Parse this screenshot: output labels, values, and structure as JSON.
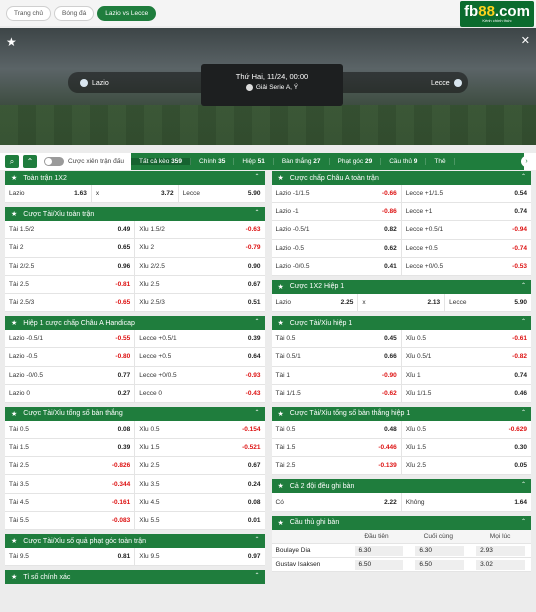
{
  "breadcrumbs": [
    "Trang chủ",
    "Bóng đá",
    "Lazio vs Lecce"
  ],
  "logo": {
    "brand_a": "fb",
    "brand_b": "88",
    "suffix": ".com",
    "tag": "Kênh chính thức"
  },
  "match": {
    "home": "Lazio",
    "away": "Lecce",
    "datetime": "Thứ Hai, 11/24, 00:00",
    "league": "Giải Serie A, Ý"
  },
  "toolbar": {
    "parlay": "Cược xiên trận đấu"
  },
  "tabs": [
    {
      "label": "Tất cả kèo",
      "count": "359"
    },
    {
      "label": "Chính",
      "count": "35"
    },
    {
      "label": "Hiệp",
      "count": "51"
    },
    {
      "label": "Bàn thắng",
      "count": "27"
    },
    {
      "label": "Phạt góc",
      "count": "29"
    },
    {
      "label": "Cầu thủ",
      "count": "9"
    },
    {
      "label": "Thẻ",
      "count": ""
    }
  ],
  "left": [
    {
      "title": "Toàn trận 1X2",
      "rows": [
        [
          [
            "Lazio",
            "1.63"
          ],
          [
            "x",
            "3.72"
          ],
          [
            "Lecce",
            "5.90"
          ]
        ]
      ]
    },
    {
      "title": "Cược Tài/Xỉu toàn trận",
      "rows": [
        [
          [
            "Tài 1.5/2",
            "0.49"
          ],
          [
            "Xỉu 1.5/2",
            "-0.63"
          ]
        ],
        [
          [
            "Tài 2",
            "0.65"
          ],
          [
            "Xỉu 2",
            "-0.79"
          ]
        ],
        [
          [
            "Tài 2/2.5",
            "0.96"
          ],
          [
            "Xỉu 2/2.5",
            "0.90"
          ]
        ],
        [
          [
            "Tài 2.5",
            "-0.81"
          ],
          [
            "Xỉu 2.5",
            "0.67"
          ]
        ],
        [
          [
            "Tài 2.5/3",
            "-0.65"
          ],
          [
            "Xỉu 2.5/3",
            "0.51"
          ]
        ]
      ]
    },
    {
      "title": "Hiệp 1 cược chấp Châu A Handicap",
      "rows": [
        [
          [
            "Lazio -0.5/1",
            "-0.55"
          ],
          [
            "Lecce +0.5/1",
            "0.39"
          ]
        ],
        [
          [
            "Lazio -0.5",
            "-0.80"
          ],
          [
            "Lecce +0.5",
            "0.64"
          ]
        ],
        [
          [
            "Lazio -0/0.5",
            "0.77"
          ],
          [
            "Lecce +0/0.5",
            "-0.93"
          ]
        ],
        [
          [
            "Lazio 0",
            "0.27"
          ],
          [
            "Lecce 0",
            "-0.43"
          ]
        ]
      ]
    },
    {
      "title": "Cược Tài/Xỉu tổng số bàn thắng",
      "rows": [
        [
          [
            "Tài 0.5",
            "0.08"
          ],
          [
            "Xỉu 0.5",
            "-0.154"
          ]
        ],
        [
          [
            "Tài 1.5",
            "0.39"
          ],
          [
            "Xỉu 1.5",
            "-0.521"
          ]
        ],
        [
          [
            "Tài 2.5",
            "-0.826"
          ],
          [
            "Xỉu 2.5",
            "0.67"
          ]
        ],
        [
          [
            "Tài 3.5",
            "-0.344"
          ],
          [
            "Xỉu 3.5",
            "0.24"
          ]
        ],
        [
          [
            "Tài 4.5",
            "-0.161"
          ],
          [
            "Xỉu 4.5",
            "0.08"
          ]
        ],
        [
          [
            "Tài 5.5",
            "-0.083"
          ],
          [
            "Xỉu 5.5",
            "0.01"
          ]
        ]
      ]
    },
    {
      "title": "Cược Tài/Xỉu số quả phạt góc toàn trận",
      "rows": [
        [
          [
            "Tài 9.5",
            "0.81"
          ],
          [
            "Xỉu 9.5",
            "0.97"
          ]
        ]
      ]
    },
    {
      "title": "Tỉ số chính xác",
      "rows": []
    }
  ],
  "right": [
    {
      "title": "Cược chấp Châu A toàn trận",
      "rows": [
        [
          [
            "Lazio -1/1.5",
            "-0.66"
          ],
          [
            "Lecce +1/1.5",
            "0.54"
          ]
        ],
        [
          [
            "Lazio -1",
            "-0.86"
          ],
          [
            "Lecce +1",
            "0.74"
          ]
        ],
        [
          [
            "Lazio -0.5/1",
            "0.82"
          ],
          [
            "Lecce +0.5/1",
            "-0.94"
          ]
        ],
        [
          [
            "Lazio -0.5",
            "0.62"
          ],
          [
            "Lecce +0.5",
            "-0.74"
          ]
        ],
        [
          [
            "Lazio -0/0.5",
            "0.41"
          ],
          [
            "Lecce +0/0.5",
            "-0.53"
          ]
        ]
      ]
    },
    {
      "title": "Cược 1X2 Hiệp 1",
      "rows": [
        [
          [
            "Lazio",
            "2.25"
          ],
          [
            "x",
            "2.13"
          ],
          [
            "Lecce",
            "5.90"
          ]
        ]
      ]
    },
    {
      "title": "Cược Tài/Xỉu hiệp 1",
      "rows": [
        [
          [
            "Tài 0.5",
            "0.45"
          ],
          [
            "Xỉu 0.5",
            "-0.61"
          ]
        ],
        [
          [
            "Tài 0.5/1",
            "0.66"
          ],
          [
            "Xỉu 0.5/1",
            "-0.82"
          ]
        ],
        [
          [
            "Tài 1",
            "-0.90"
          ],
          [
            "Xỉu 1",
            "0.74"
          ]
        ],
        [
          [
            "Tài 1/1.5",
            "-0.62"
          ],
          [
            "Xỉu 1/1.5",
            "0.46"
          ]
        ]
      ]
    },
    {
      "title": "Cược Tài/Xỉu tổng số bàn thắng hiệp 1",
      "rows": [
        [
          [
            "Tài 0.5",
            "0.48"
          ],
          [
            "Xỉu 0.5",
            "-0.629"
          ]
        ],
        [
          [
            "Tài 1.5",
            "-0.446"
          ],
          [
            "Xỉu 1.5",
            "0.30"
          ]
        ],
        [
          [
            "Tài 2.5",
            "-0.139"
          ],
          [
            "Xỉu 2.5",
            "0.05"
          ]
        ]
      ]
    },
    {
      "title": "Cả 2 đội đều ghi bàn",
      "rows": [
        [
          [
            "Có",
            "2.22"
          ],
          [
            "Không",
            "1.64"
          ]
        ]
      ]
    }
  ],
  "scorers": {
    "title": "Cầu thủ ghi bàn",
    "headers": [
      "",
      "Đầu tiên",
      "Cuối cùng",
      "Mọi lúc"
    ],
    "rows": [
      [
        "Boulaye Dia",
        "6.30",
        "6.30",
        "2.93"
      ],
      [
        "Gustav Isaksen",
        "6.50",
        "6.50",
        "3.02"
      ]
    ]
  }
}
